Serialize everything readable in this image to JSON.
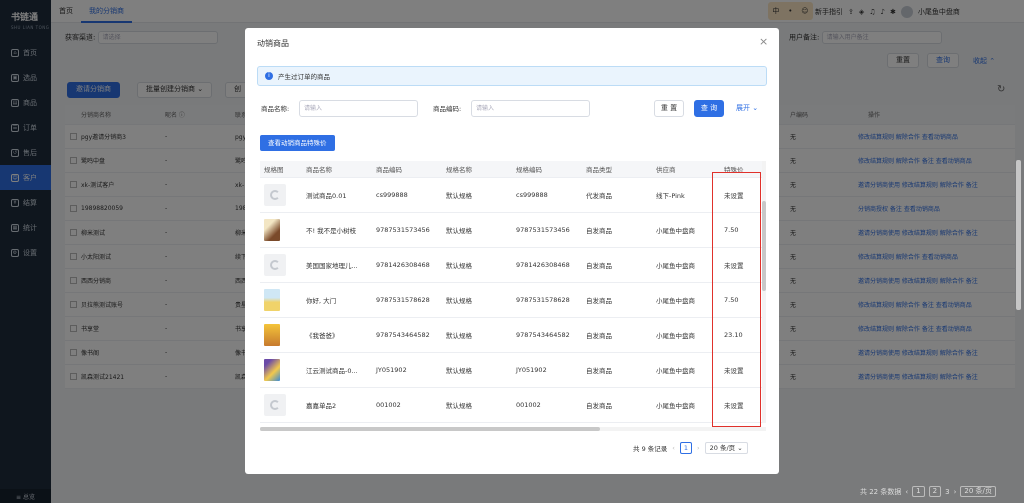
{
  "app": {
    "logo": "书链通",
    "logo_sub": "SHU LIAN TONG"
  },
  "sidebar": {
    "items": [
      {
        "label": "首页"
      },
      {
        "label": "选品"
      },
      {
        "label": "商品"
      },
      {
        "label": "订单"
      },
      {
        "label": "售后"
      },
      {
        "label": "客户"
      },
      {
        "label": "结算"
      },
      {
        "label": "统计"
      },
      {
        "label": "设置"
      }
    ],
    "footer": "≡ 总览"
  },
  "topbar": {
    "tabs": [
      "首页",
      "我的分销商"
    ],
    "popup": [
      "中",
      "•",
      "☺"
    ],
    "guide": "新手指引",
    "user": "小尾鱼中盘商"
  },
  "background": {
    "filter_label": "获客渠道:",
    "filter_placeholder": "请选择",
    "remark_label": "用户备注:",
    "remark_placeholder": "请输入用户备注",
    "reset": "重置",
    "search": "查询",
    "collapse": "收起 ⌃",
    "invite_btn": "邀请分销商",
    "batch_btn": "批量创建分销商 ⌄",
    "create_btn": "创",
    "headers": [
      "分销商名称",
      "昵名 ⓘ",
      "联系人",
      "户编码",
      "",
      "操作"
    ],
    "rows": [
      {
        "name": "pgy邀请分销商3",
        "nick": "-",
        "contact": "pgy邀\n0000",
        "code": "无",
        "ops": "修改结算规则  解除合作  查看动销商品"
      },
      {
        "name": "鹭鸣中盘",
        "nick": "-",
        "contact": "鹭鸣中\n0000",
        "code": "无",
        "ops": "修改结算规则  解除合作  备注  查看动销商品"
      },
      {
        "name": "xk-测试客户",
        "nick": "-",
        "contact": "xk-\n测试\n43",
        "code": "无",
        "ops": "邀请分销商使用  修改结算规则  解除合作  备注"
      },
      {
        "name": "19898820059",
        "nick": "-",
        "contact": "1989\n8200",
        "code": "无",
        "ops": "分销商授权  备注  查看动销商品"
      },
      {
        "name": "柳米测试",
        "nick": "-",
        "contact": "柳米(",
        "code": "无",
        "ops": "邀请分销商使用  修改结算规则  解除合作  备注"
      },
      {
        "name": "小太阳测试",
        "nick": "-",
        "contact": "续下-\n小太\n21",
        "code": "无",
        "ops": "修改结算规则  解除合作  查看动销商品"
      },
      {
        "name": "西西分销商",
        "nick": "-",
        "contact": "西西\n0725",
        "code": "无",
        "ops": "邀请分销商使用  修改结算规则  解除合作  备注"
      },
      {
        "name": "贝拉熊测试账号",
        "nick": "-",
        "contact": "贵星(",
        "code": "无",
        "ops": "修改结算规则  解除合作  备注  查看动销商品"
      },
      {
        "name": "书享堂",
        "nick": "-",
        "contact": "书享",
        "code": "无",
        "ops": "修改结算规则  解除合作  备注  查看动销商品"
      },
      {
        "name": "像书阁",
        "nick": "-",
        "contact": "像书\n",
        "code": "无",
        "ops": "邀请分销商使用  修改结算规则  解除合作  备注"
      },
      {
        "name": "凯森测试21421",
        "nick": "-",
        "contact": "凯森\n",
        "code": "无",
        "ops": "邀请分销商使用  修改结算规则  解除合作  备注"
      }
    ],
    "footer_total": "共 22 条数据",
    "footer_pages": [
      "1",
      "2",
      "3"
    ],
    "footer_size": "20 条/页"
  },
  "modal": {
    "title": "动销商品",
    "info": "产生过订单的商品",
    "name_label": "商品名称:",
    "name_placeholder": "请输入",
    "code_label": "商品编码:",
    "code_placeholder": "请输入",
    "reset": "重 置",
    "search": "查 询",
    "expand": "展开 ⌄",
    "price_btn": "查看动销商品特殊价",
    "headers": [
      "规格图",
      "商品名称",
      "商品编码",
      "规格名称",
      "规格编码",
      "商品类型",
      "供应商",
      "特殊价"
    ],
    "rows": [
      {
        "img": "placeholder",
        "name": "测试商品0.01",
        "code": "cs999888",
        "spec": "默认规格",
        "spec_code": "cs999888",
        "type": "代发商品",
        "supplier": "线下-Pink",
        "price": "未设置"
      },
      {
        "img": "cover1",
        "name": "不! 我不是小树枝",
        "code": "9787531573456",
        "spec": "默认规格",
        "spec_code": "9787531573456",
        "type": "自发商品",
        "supplier": "小尾鱼中盘商",
        "price": "7.50"
      },
      {
        "img": "placeholder",
        "name": "美国国家地理儿...",
        "code": "9781426308468",
        "spec": "默认规格",
        "spec_code": "9781426308468",
        "type": "自发商品",
        "supplier": "小尾鱼中盘商",
        "price": "未设置"
      },
      {
        "img": "cover2",
        "name": "你好, 大门",
        "code": "9787531578628",
        "spec": "默认规格",
        "spec_code": "9787531578628",
        "type": "自发商品",
        "supplier": "小尾鱼中盘商",
        "price": "7.50"
      },
      {
        "img": "cover3",
        "name": "《我爸爸》",
        "code": "9787543464582",
        "spec": "默认规格",
        "spec_code": "9787543464582",
        "type": "自发商品",
        "supplier": "小尾鱼中盘商",
        "price": "23.10"
      },
      {
        "img": "cover4",
        "name": "江云测试商品-0...",
        "code": "JY051902",
        "spec": "默认规格",
        "spec_code": "JY051902",
        "type": "自发商品",
        "supplier": "小尾鱼中盘商",
        "price": "未设置"
      },
      {
        "img": "placeholder",
        "name": "嘉嘉单品2",
        "code": "001002",
        "spec": "默认规格",
        "spec_code": "001002",
        "type": "自发商品",
        "supplier": "小尾鱼中盘商",
        "price": "未设置"
      }
    ],
    "total": "共 9 条记录",
    "page": "1",
    "page_size": "20 条/页 ⌄",
    "prev": "‹",
    "next": "›"
  },
  "colors": {
    "primary": "#2f6fe4",
    "sidebar": "#1f2d3d",
    "highlight": "#e0312b"
  }
}
